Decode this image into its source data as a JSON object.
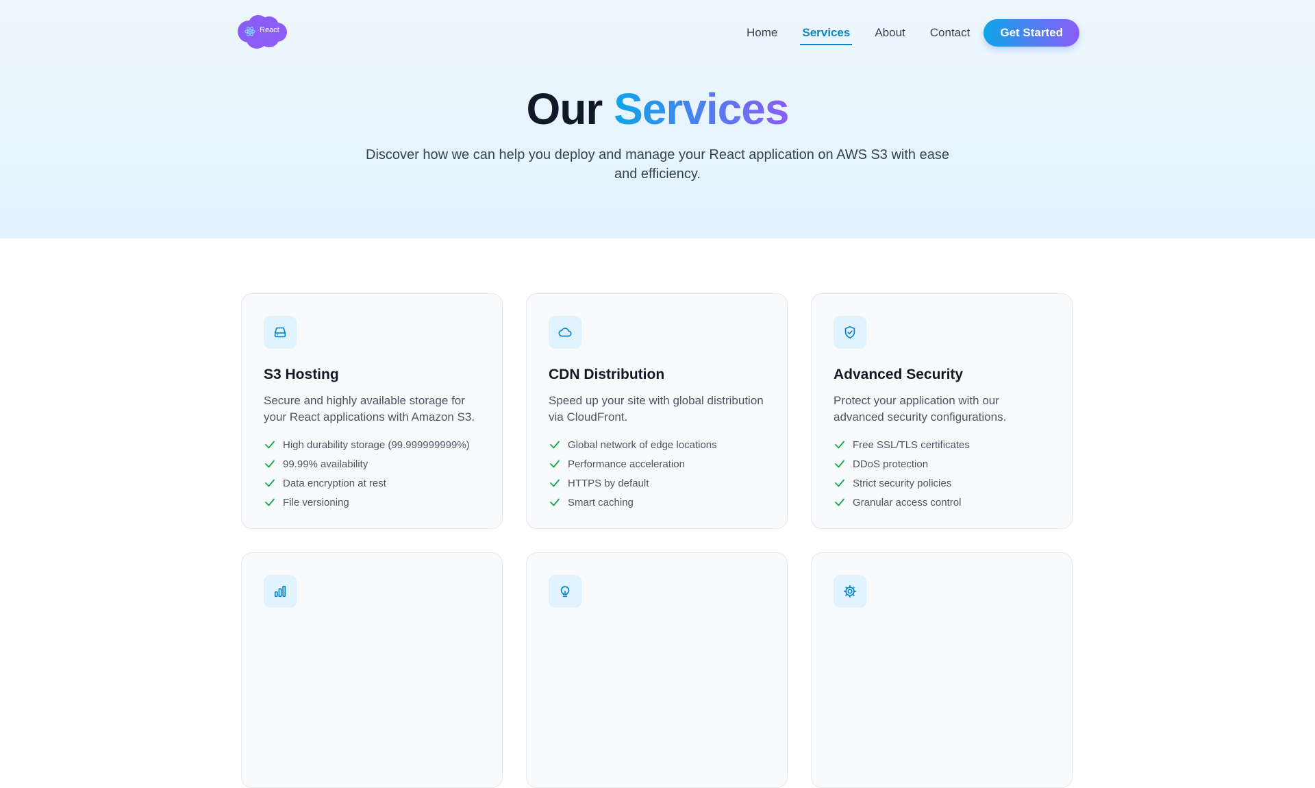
{
  "brand": {
    "logo_text": "React"
  },
  "nav": {
    "links": [
      {
        "label": "Home"
      },
      {
        "label": "Services",
        "active": true
      },
      {
        "label": "About"
      },
      {
        "label": "Contact"
      }
    ],
    "cta_label": "Get Started"
  },
  "hero": {
    "title_part1": "Our",
    "title_part2": "Services",
    "subtitle": "Discover how we can help you deploy and manage your React application on AWS S3 with ease and efficiency."
  },
  "services": [
    {
      "icon": "hard-drive-icon",
      "title": "S3 Hosting",
      "description": "Secure and highly available storage for your React applications with Amazon S3.",
      "features": [
        "High durability storage (99.999999999%)",
        "99.99% availability",
        "Data encryption at rest",
        "File versioning"
      ]
    },
    {
      "icon": "cloud-icon",
      "title": "CDN Distribution",
      "description": "Speed up your site with global distribution via CloudFront.",
      "features": [
        "Global network of edge locations",
        "Performance acceleration",
        "HTTPS by default",
        "Smart caching"
      ]
    },
    {
      "icon": "shield-check-icon",
      "title": "Advanced Security",
      "description": "Protect your application with our advanced security configurations.",
      "features": [
        "Free SSL/TLS certificates",
        "DDoS protection",
        "Strict security policies",
        "Granular access control"
      ]
    },
    {
      "icon": "bar-chart-icon",
      "title": "",
      "description": "",
      "features": []
    },
    {
      "icon": "lightbulb-icon",
      "title": "",
      "description": "",
      "features": []
    },
    {
      "icon": "gear-icon",
      "title": "",
      "description": "",
      "features": []
    }
  ],
  "colors": {
    "accent": "#0ea5e9",
    "accent_gradient_end": "#8b5cf6",
    "check": "#16a34a",
    "icon_bg": "#e0f2fe"
  }
}
